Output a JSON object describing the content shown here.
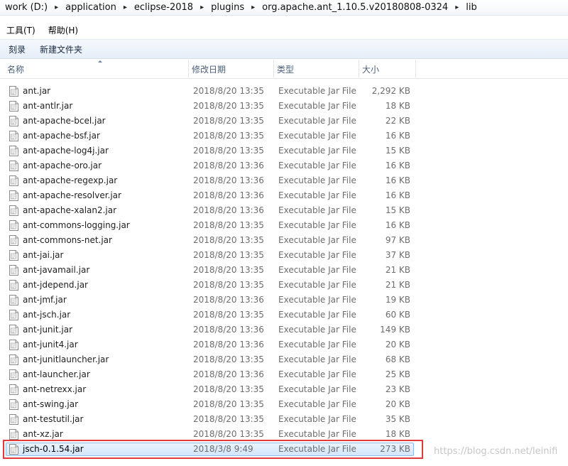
{
  "breadcrumb": [
    "work (D:)",
    "application",
    "eclipse-2018",
    "plugins",
    "org.apache.ant_1.10.5.v20180808-0324",
    "lib"
  ],
  "menu": [
    "工具(T)",
    "帮助(H)"
  ],
  "toolbar": [
    "刻录",
    "新建文件夹"
  ],
  "columns": {
    "name": "名称",
    "date": "修改日期",
    "type": "类型",
    "size": "大小"
  },
  "files": [
    {
      "name": "ant.jar",
      "date": "2018/8/20 13:35",
      "type": "Executable Jar File",
      "size": "2,292 KB"
    },
    {
      "name": "ant-antlr.jar",
      "date": "2018/8/20 13:35",
      "type": "Executable Jar File",
      "size": "18 KB"
    },
    {
      "name": "ant-apache-bcel.jar",
      "date": "2018/8/20 13:35",
      "type": "Executable Jar File",
      "size": "22 KB"
    },
    {
      "name": "ant-apache-bsf.jar",
      "date": "2018/8/20 13:35",
      "type": "Executable Jar File",
      "size": "16 KB"
    },
    {
      "name": "ant-apache-log4j.jar",
      "date": "2018/8/20 13:35",
      "type": "Executable Jar File",
      "size": "15 KB"
    },
    {
      "name": "ant-apache-oro.jar",
      "date": "2018/8/20 13:36",
      "type": "Executable Jar File",
      "size": "16 KB"
    },
    {
      "name": "ant-apache-regexp.jar",
      "date": "2018/8/20 13:36",
      "type": "Executable Jar File",
      "size": "16 KB"
    },
    {
      "name": "ant-apache-resolver.jar",
      "date": "2018/8/20 13:36",
      "type": "Executable Jar File",
      "size": "16 KB"
    },
    {
      "name": "ant-apache-xalan2.jar",
      "date": "2018/8/20 13:36",
      "type": "Executable Jar File",
      "size": "15 KB"
    },
    {
      "name": "ant-commons-logging.jar",
      "date": "2018/8/20 13:35",
      "type": "Executable Jar File",
      "size": "16 KB"
    },
    {
      "name": "ant-commons-net.jar",
      "date": "2018/8/20 13:35",
      "type": "Executable Jar File",
      "size": "97 KB"
    },
    {
      "name": "ant-jai.jar",
      "date": "2018/8/20 13:35",
      "type": "Executable Jar File",
      "size": "37 KB"
    },
    {
      "name": "ant-javamail.jar",
      "date": "2018/8/20 13:35",
      "type": "Executable Jar File",
      "size": "21 KB"
    },
    {
      "name": "ant-jdepend.jar",
      "date": "2018/8/20 13:35",
      "type": "Executable Jar File",
      "size": "21 KB"
    },
    {
      "name": "ant-jmf.jar",
      "date": "2018/8/20 13:36",
      "type": "Executable Jar File",
      "size": "19 KB"
    },
    {
      "name": "ant-jsch.jar",
      "date": "2018/8/20 13:35",
      "type": "Executable Jar File",
      "size": "60 KB"
    },
    {
      "name": "ant-junit.jar",
      "date": "2018/8/20 13:36",
      "type": "Executable Jar File",
      "size": "149 KB"
    },
    {
      "name": "ant-junit4.jar",
      "date": "2018/8/20 13:36",
      "type": "Executable Jar File",
      "size": "20 KB"
    },
    {
      "name": "ant-junitlauncher.jar",
      "date": "2018/8/20 13:35",
      "type": "Executable Jar File",
      "size": "68 KB"
    },
    {
      "name": "ant-launcher.jar",
      "date": "2018/8/20 13:36",
      "type": "Executable Jar File",
      "size": "25 KB"
    },
    {
      "name": "ant-netrexx.jar",
      "date": "2018/8/20 13:35",
      "type": "Executable Jar File",
      "size": "23 KB"
    },
    {
      "name": "ant-swing.jar",
      "date": "2018/8/20 13:35",
      "type": "Executable Jar File",
      "size": "20 KB"
    },
    {
      "name": "ant-testutil.jar",
      "date": "2018/8/20 13:35",
      "type": "Executable Jar File",
      "size": "35 KB"
    },
    {
      "name": "ant-xz.jar",
      "date": "2018/8/20 13:35",
      "type": "Executable Jar File",
      "size": "18 KB"
    },
    {
      "name": "jsch-0.1.54.jar",
      "date": "2018/3/8 9:49",
      "type": "Executable Jar File",
      "size": "273 KB",
      "selected": true
    }
  ],
  "watermark": "https://blog.csdn.net/leinifi",
  "colors": {
    "highlight_border": "#e03a3a",
    "selection": "#d3e6fb"
  }
}
